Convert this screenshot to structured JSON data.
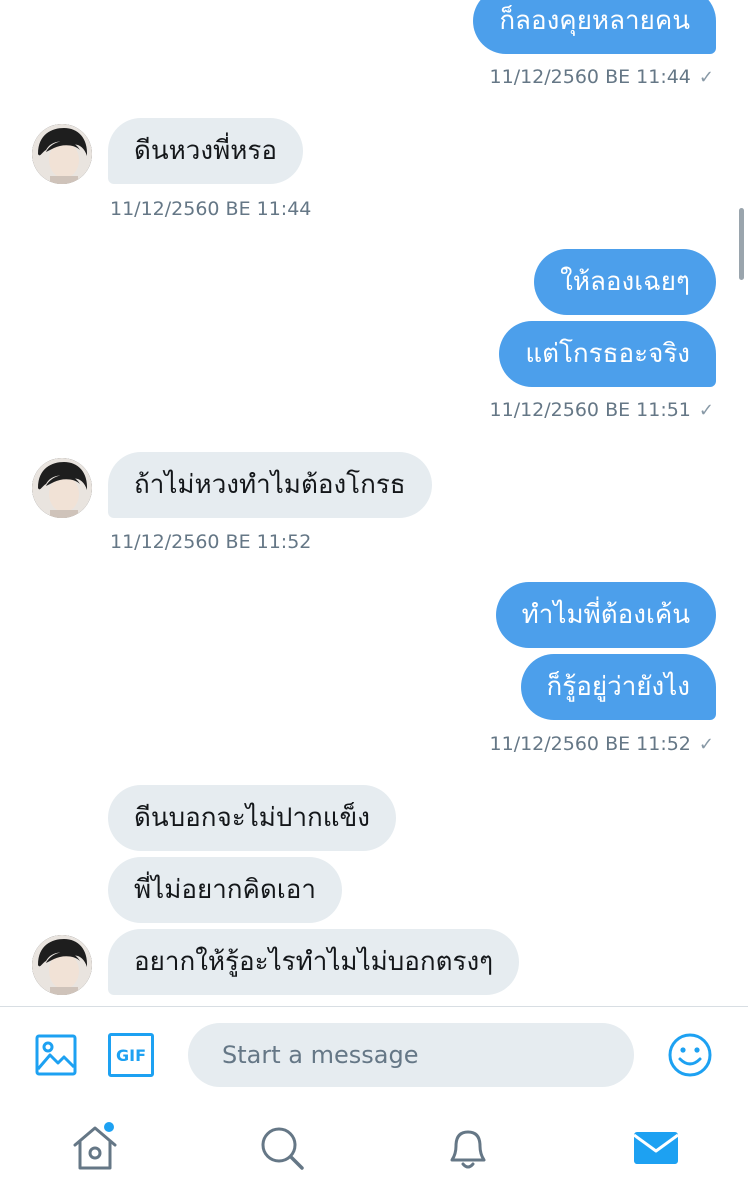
{
  "messages": {
    "m1": {
      "text": "ก็ลองคุยหลายคน",
      "time": "11/12/2560 BE 11:44"
    },
    "m2": {
      "text": "ดีนหวงพี่หรอ",
      "time": "11/12/2560 BE 11:44"
    },
    "m3": {
      "text": "ให้ลองเฉยๆ"
    },
    "m4": {
      "text": "แต่โกรธอะจริง",
      "time": "11/12/2560 BE 11:51"
    },
    "m5": {
      "text": "ถ้าไม่หวงทำไมต้องโกรธ",
      "time": "11/12/2560 BE 11:52"
    },
    "m6": {
      "text": "ทำไมพี่ต้องเค้น"
    },
    "m7": {
      "text": "ก็รู้อยู่ว่ายังไง",
      "time": "11/12/2560 BE 11:52"
    },
    "m8": {
      "text": "ดีนบอกจะไม่ปากแข็ง"
    },
    "m9": {
      "text": "พี่ไม่อยากคิดเอา"
    },
    "m10": {
      "text": "อยากให้รู้อะไรทำไมไม่บอกตรงๆ"
    }
  },
  "read_mark": "✓",
  "composer": {
    "placeholder": "Start a message",
    "gif_label": "GIF",
    "icons": [
      "image-icon",
      "gif-icon",
      "emoji-icon"
    ]
  },
  "tabs": [
    "home-icon",
    "search-icon",
    "notifications-icon",
    "messages-icon"
  ],
  "colors": {
    "accent": "#1DA1F2",
    "bubble_out": "#4C9FEB",
    "bubble_in": "#E6ECF0",
    "timestamp": "#657786"
  }
}
